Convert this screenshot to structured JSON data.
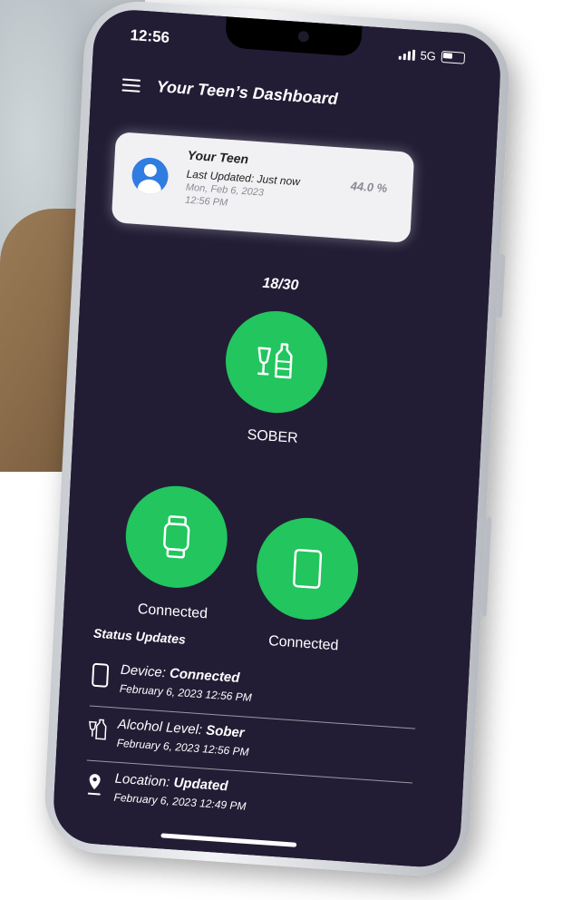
{
  "status_bar": {
    "time": "12:56",
    "network": "5G"
  },
  "header": {
    "title": "Your Teen’s Dashboard"
  },
  "teen_card": {
    "name": "Your Teen",
    "last_updated": "Last Updated: Just now",
    "date": "Mon, Feb 6, 2023",
    "time": "12:56 PM",
    "bac": "44.0 %"
  },
  "main_status": {
    "counter": "18/30",
    "label": "SOBER",
    "color": "#22c55e"
  },
  "devices": {
    "watch_label": "Connected",
    "phone_label": "Connected"
  },
  "status_updates": {
    "heading": "Status Updates",
    "items": [
      {
        "title_prefix": "Device: ",
        "title_value": "Connected",
        "date": "February 6, 2023 12:56 PM",
        "icon": "phone-icon"
      },
      {
        "title_prefix": "Alcohol Level: ",
        "title_value": "Sober",
        "date": "February 6, 2023 12:56 PM",
        "icon": "drinks-icon"
      },
      {
        "title_prefix": "Location: ",
        "title_value": "Updated",
        "date": "February 6, 2023 12:49 PM",
        "icon": "location-pin-icon"
      }
    ]
  },
  "theme": {
    "screen_bg": "#221d35",
    "accent_green": "#22c55e",
    "avatar_blue": "#2f7de1"
  }
}
